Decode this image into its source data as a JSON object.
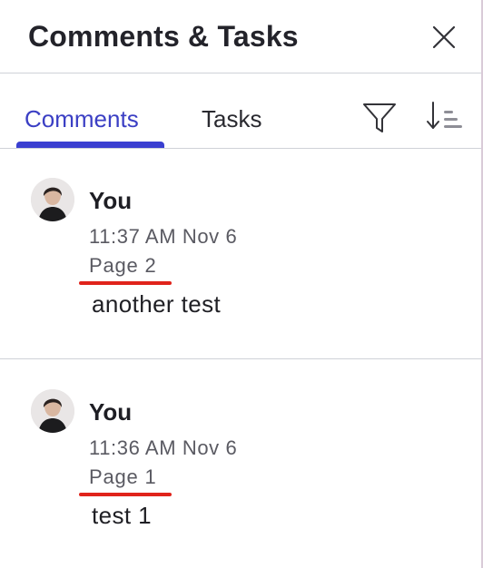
{
  "panel": {
    "title": "Comments & Tasks"
  },
  "tabs": [
    {
      "label": "Comments",
      "active": true
    },
    {
      "label": "Tasks",
      "active": false
    }
  ],
  "icons": {
    "close": "close-icon",
    "filter": "filter-icon",
    "sort": "sort-icon"
  },
  "comments": [
    {
      "author": "You",
      "timestamp": "11:37 AM Nov 6",
      "page": "Page 2",
      "text": "another test"
    },
    {
      "author": "You",
      "timestamp": "11:36 AM Nov 6",
      "page": "Page 1",
      "text": "test 1"
    }
  ],
  "colors": {
    "accent": "#3a3fd0",
    "annotation_red": "#e0231b",
    "divider": "#cfd2d8"
  }
}
